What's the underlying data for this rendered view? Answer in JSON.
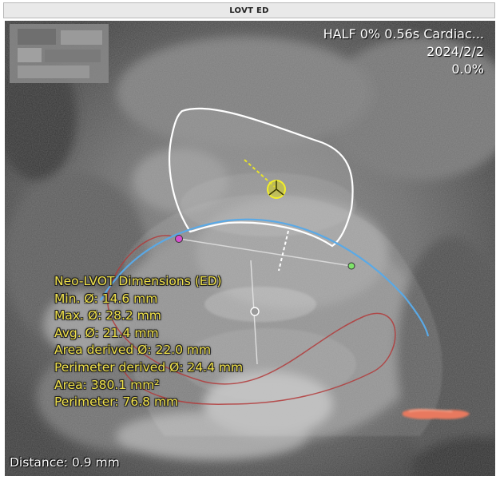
{
  "window": {
    "title": "LOVT ED"
  },
  "overlay": {
    "series_info": "HALF 0% 0.56s Cardiac...",
    "date": "2024/2/2",
    "phase": "0.0%"
  },
  "measurements": {
    "heading": "Neo-LVOT Dimensions (ED)",
    "min_diameter": "Min. Ø: 14.6 mm",
    "max_diameter": "Max. Ø: 28.2 mm",
    "avg_diameter": "Avg. Ø: 21.4 mm",
    "area_derived": "Area derived Ø: 22.0 mm",
    "perimeter_derived": "Perimeter derived Ø: 24.4 mm",
    "area": "Area: 380.1 mm²",
    "perimeter": "Perimeter: 76.8 mm"
  },
  "distance": {
    "label": "Distance: 0.9 mm"
  },
  "colors": {
    "measure_text": "#f0e14a",
    "annulus_curve": "#5aa9e6",
    "contour": "#ffffff",
    "red_contour": "#b33a3a",
    "calcification": "#e8795e",
    "handle_magenta": "#d94fd0",
    "handle_green": "#7ee36a",
    "center_marker": "#e8e42a"
  }
}
